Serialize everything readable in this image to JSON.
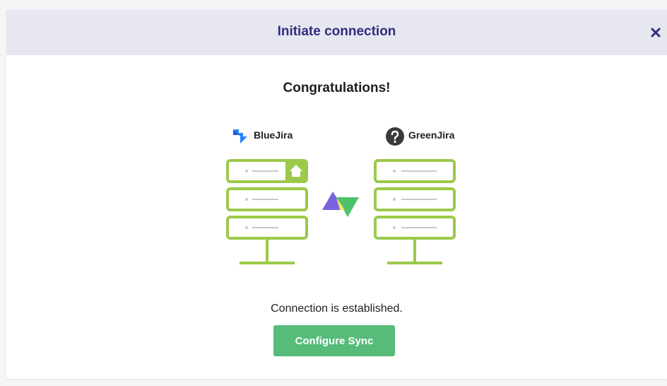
{
  "modal": {
    "title": "Initiate connection",
    "close_icon": "close-icon",
    "heading": "Congratulations!",
    "status": "Connection is established.",
    "configure_label": "Configure Sync"
  },
  "connection": {
    "source": {
      "name": "BlueJira",
      "icon": "jira-logo-icon"
    },
    "target": {
      "name": "GreenJira",
      "icon": "question-mark-icon"
    },
    "link_icon": "exalate-logo-icon"
  },
  "colors": {
    "header_bg": "#e6e7f0",
    "title": "#2f2d7e",
    "server_green": "#9cc94a",
    "button_green": "#57bb7a",
    "jira_blue": "#2684ff"
  }
}
